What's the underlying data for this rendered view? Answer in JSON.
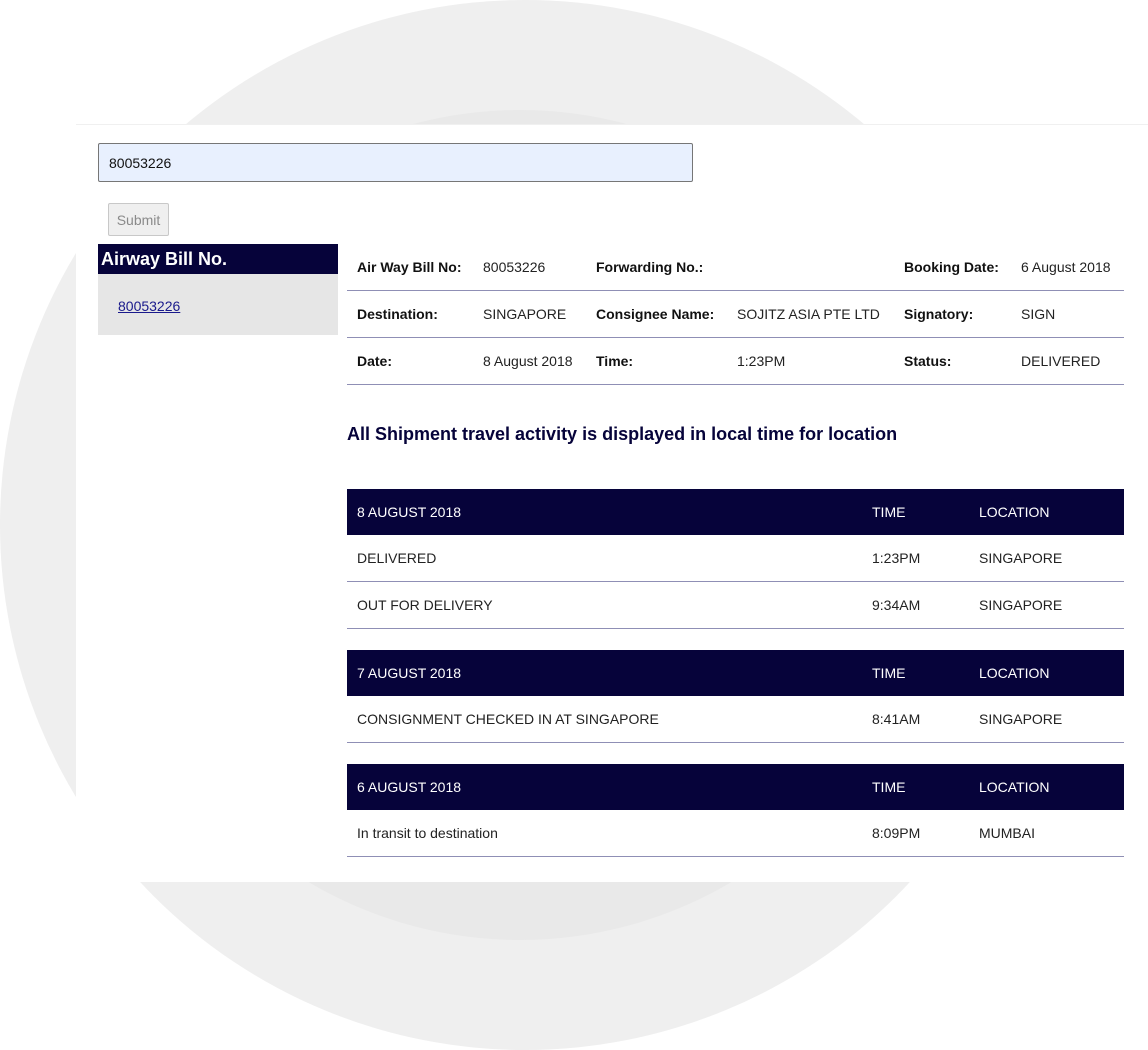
{
  "search": {
    "value": "80053226"
  },
  "submit_label": "Submit",
  "sidebar": {
    "title": "Airway Bill No.",
    "link": "80053226"
  },
  "details": {
    "awb_label": "Air Way Bill No:",
    "awb_value": "80053226",
    "forwarding_label": "Forwarding No.:",
    "forwarding_value": "",
    "booking_label": "Booking Date:",
    "booking_value": "6 August 2018",
    "destination_label": "Destination:",
    "destination_value": "SINGAPORE",
    "consignee_label": "Consignee Name:",
    "consignee_value": "SOJITZ ASIA PTE LTD",
    "signatory_label": "Signatory:",
    "signatory_value": "SIGN",
    "date_label": "Date:",
    "date_value": "8 August 2018",
    "time_label": "Time:",
    "time_value": "1:23PM",
    "status_label": "Status:",
    "status_value": "DELIVERED"
  },
  "headline": "All Shipment travel activity is displayed in local time for location",
  "activity": [
    {
      "date": "8 AUGUST 2018",
      "time_header": "TIME",
      "location_header": "LOCATION",
      "rows": [
        {
          "activity": "DELIVERED",
          "time": "1:23PM",
          "location": "SINGAPORE"
        },
        {
          "activity": "OUT FOR DELIVERY",
          "time": "9:34AM",
          "location": "SINGAPORE"
        }
      ]
    },
    {
      "date": "7 AUGUST 2018",
      "time_header": "TIME",
      "location_header": "LOCATION",
      "rows": [
        {
          "activity": "CONSIGNMENT CHECKED IN AT SINGAPORE",
          "time": "8:41AM",
          "location": "SINGAPORE"
        }
      ]
    },
    {
      "date": "6 AUGUST 2018",
      "time_header": "TIME",
      "location_header": "LOCATION",
      "rows": [
        {
          "activity": "In transit to destination",
          "time": "8:09PM",
          "location": "MUMBAI"
        }
      ]
    }
  ],
  "colors": {
    "navy": "#06033a",
    "input_bg": "#e8f0fe",
    "sidebar_bg": "#e6e6e6",
    "divider": "#8f8fb5"
  }
}
